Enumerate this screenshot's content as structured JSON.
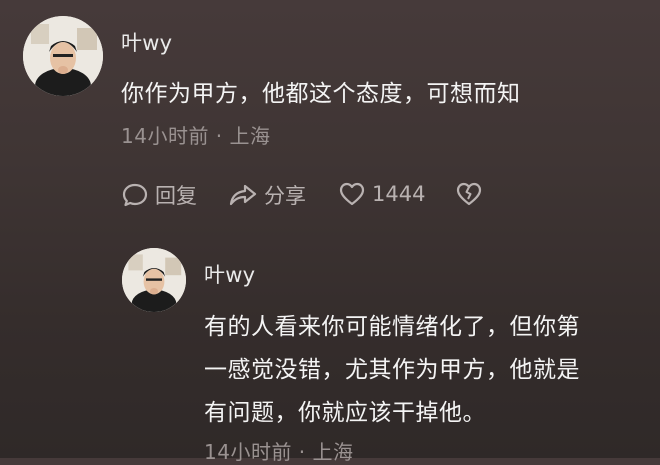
{
  "comments": [
    {
      "username": "叶wy",
      "text": "你作为甲方，他都这个态度，可想而知",
      "meta": "14小时前 · 上海",
      "actions": {
        "reply": "回复",
        "share": "分享",
        "likes": "1444"
      }
    },
    {
      "username": "叶wy",
      "text_lines": [
        "有的人看来你可能情绪化了，但你第",
        "一感觉没错，尤其作为甲方，他就是",
        "有问题，你就应该干掉他。"
      ],
      "meta": "14小时前 · 上海"
    }
  ]
}
